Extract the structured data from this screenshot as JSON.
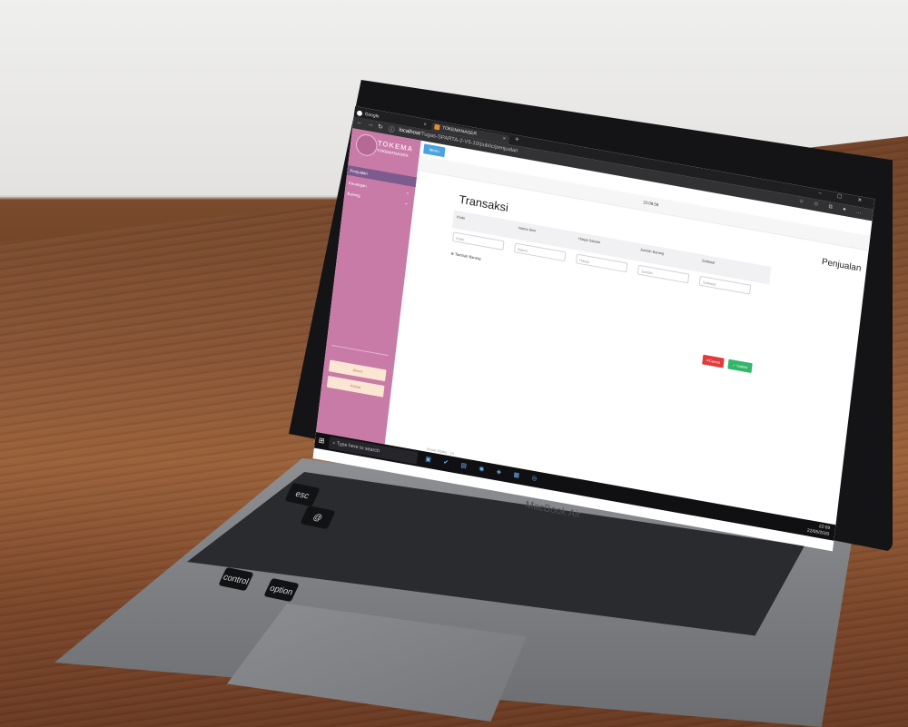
{
  "browser": {
    "tabs": [
      {
        "label": "Google",
        "favicon_color": "#ffffff"
      },
      {
        "label": "TOKEMANAGER",
        "favicon_color": "#e58b30"
      }
    ],
    "url_host": "localhost",
    "url_path": "/Tugas-SPARTA-2-V5-10/public/penjualan"
  },
  "sidebar": {
    "logo_title": "TOKEMA",
    "logo_subtitle": "TOKEMANAGER",
    "items": [
      {
        "label": "Penjualan",
        "active": true,
        "chevron": ""
      },
      {
        "label": "Keuangan",
        "active": false,
        "chevron": "⌄"
      },
      {
        "label": "Barang",
        "active": false,
        "chevron": "⌄"
      }
    ],
    "bottom_buttons": [
      {
        "label": "About"
      },
      {
        "label": "Keluar"
      }
    ]
  },
  "main": {
    "menu_button": "Menu",
    "clock": "22:09:56",
    "page_title": "Transaksi",
    "section_title": "Penjualan",
    "columns": [
      "Kode",
      "Nama Item",
      "Harga Satuan",
      "Jumlah Barang",
      "Subtotal"
    ],
    "placeholders": [
      "Kode",
      "Nama",
      "Harga",
      "Jumlah",
      "Subtotal"
    ],
    "add_row_label": "Tambah Barang",
    "cancel_label": "Cancel",
    "submit_label": "Submit",
    "colors": {
      "sidebar": "#c97ba8",
      "active_item": "#7e5b8f",
      "menu": "#4aa3df",
      "cancel": "#e23b3b",
      "submit": "#33b56a"
    }
  },
  "taskbar": {
    "search_placeholder": "Type here to search",
    "window_label": "Visual Studio - 10",
    "time": "22:09",
    "date": "22/05/2020"
  },
  "laptop": {
    "brand": "MacBook Air"
  }
}
